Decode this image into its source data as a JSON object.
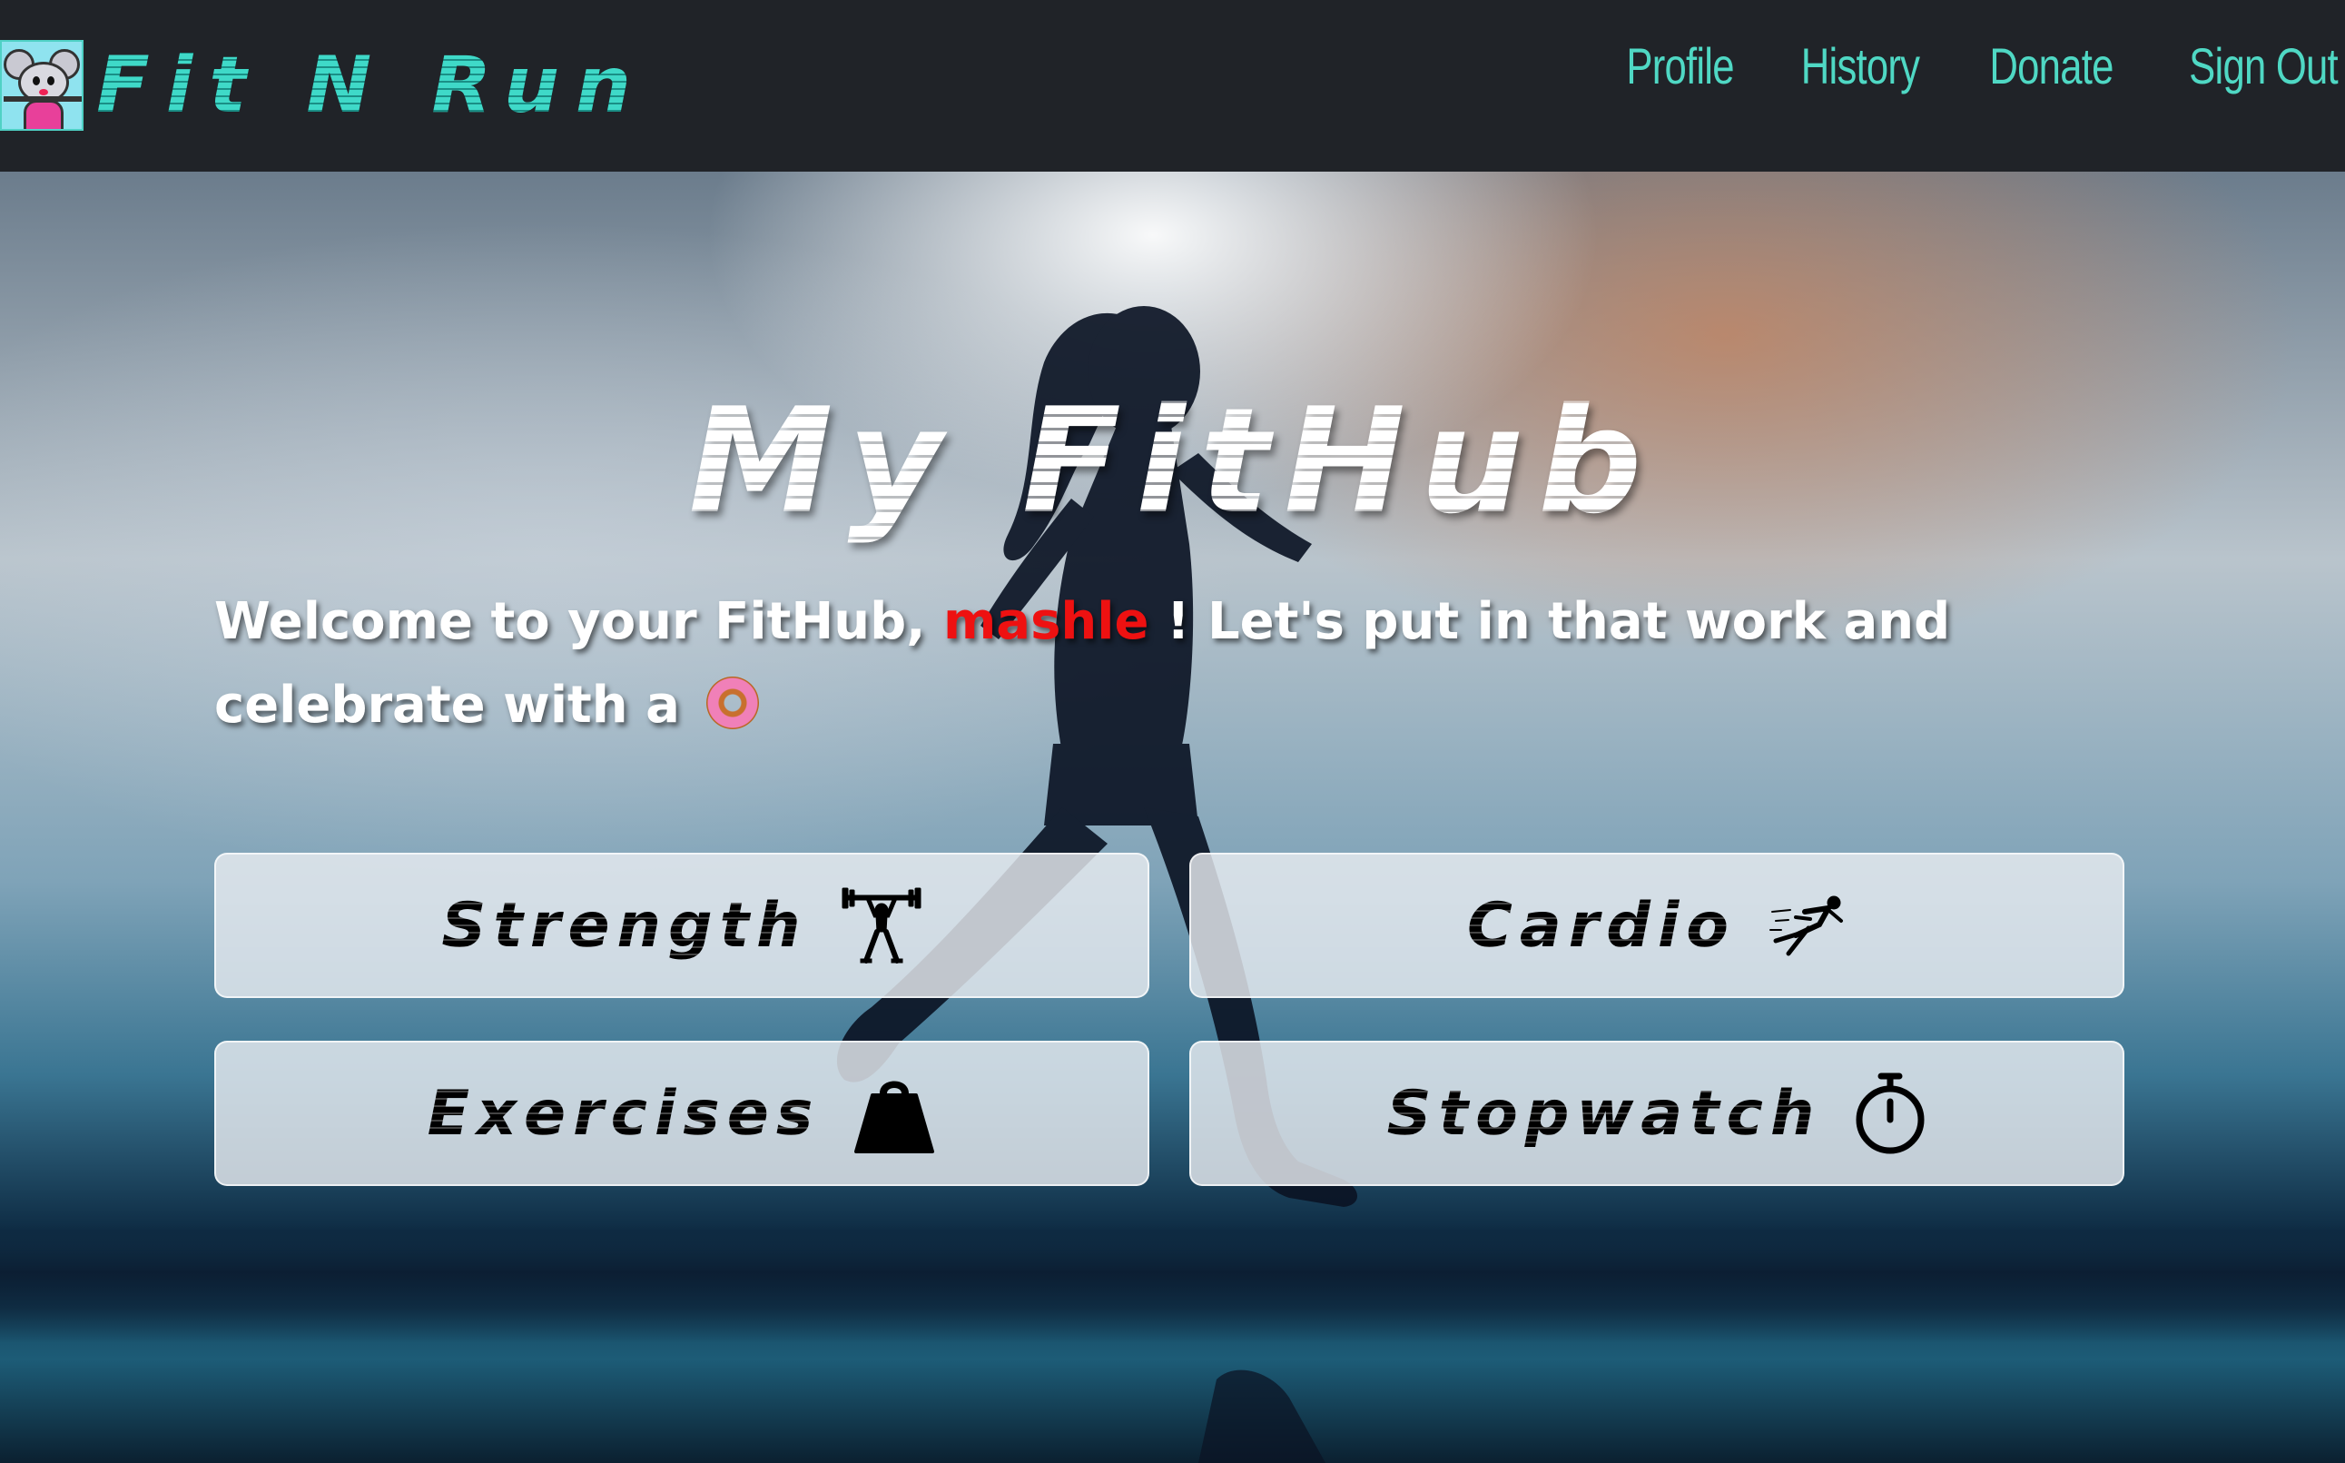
{
  "nav": {
    "brand": "Fit N Run",
    "links": [
      "Profile",
      "History",
      "Donate",
      "Sign Out"
    ]
  },
  "hero": {
    "title": "My FitHub",
    "welcome_prefix": "Welcome to your FitHub, ",
    "username": "mashle",
    "welcome_suffix": " ! Let's put in that work and celebrate with a ",
    "celebrate_icon": "donut-emoji"
  },
  "tiles": [
    {
      "label": "Strength",
      "icon": "weightlifter-icon"
    },
    {
      "label": "Cardio",
      "icon": "runner-icon"
    },
    {
      "label": "Exercises",
      "icon": "kettlebell-weight-icon"
    },
    {
      "label": "Stopwatch",
      "icon": "stopwatch-icon"
    }
  ],
  "colors": {
    "navbar_bg": "#202328",
    "accent": "#4fd8c4",
    "username": "#ee1111"
  }
}
